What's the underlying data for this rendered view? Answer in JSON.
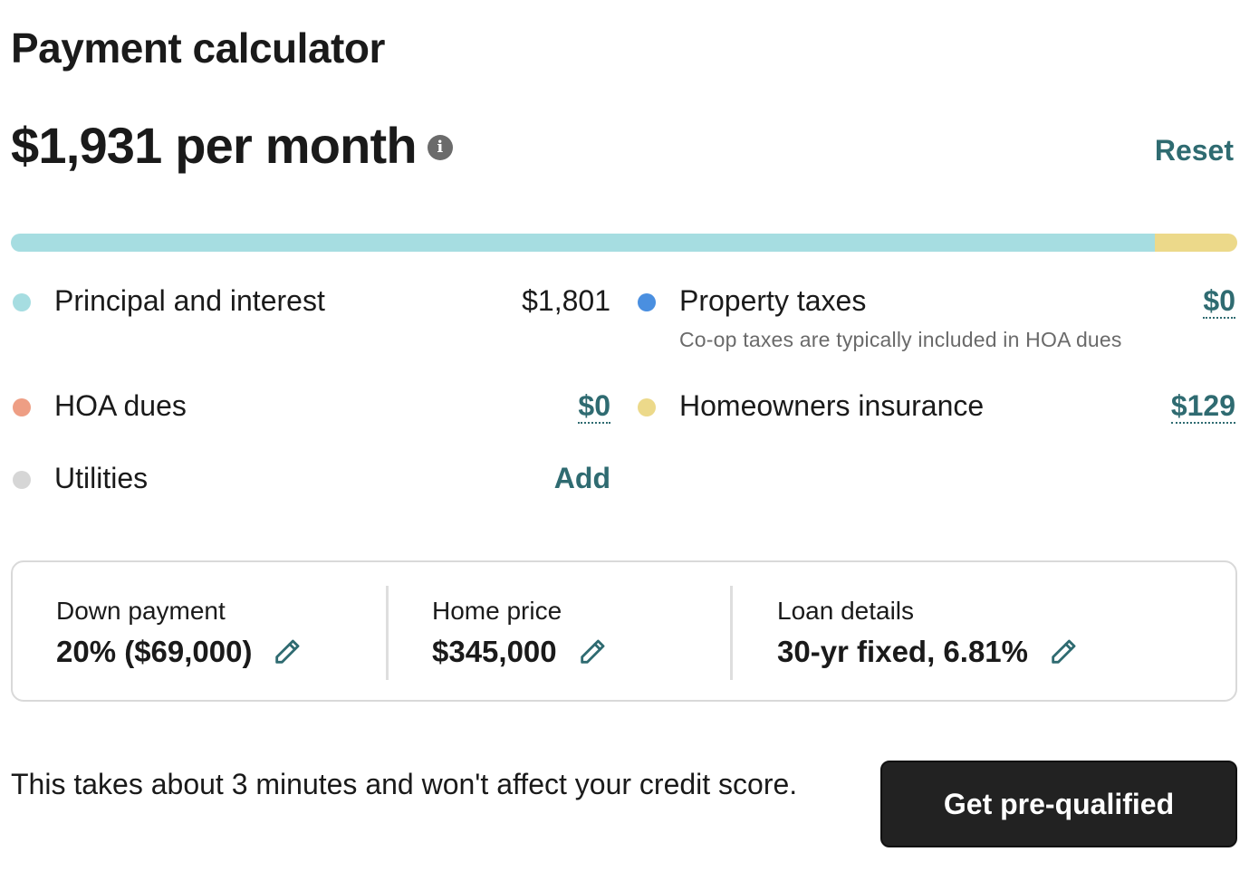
{
  "title": "Payment calculator",
  "summary": {
    "monthly_text": "$1,931 per month",
    "info_icon": "info-icon",
    "reset_label": "Reset"
  },
  "breakdown_bar": {
    "segments": [
      {
        "name": "Principal and interest",
        "value": 1801,
        "color": "#a6dde1"
      },
      {
        "name": "Property taxes",
        "value": 0,
        "color": "#4a8fe0"
      },
      {
        "name": "HOA dues",
        "value": 0,
        "color": "#ee9e84"
      },
      {
        "name": "Homeowners insurance",
        "value": 129,
        "color": "#ecd98a"
      },
      {
        "name": "Utilities",
        "value": 0,
        "color": "#d6d6d6"
      }
    ]
  },
  "items": {
    "principal": {
      "label": "Principal and interest",
      "value": "$1,801",
      "color": "#a6dde1"
    },
    "property_taxes": {
      "label": "Property taxes",
      "value": "$0",
      "note": "Co-op taxes are typically included in HOA dues",
      "color": "#4a8fe0"
    },
    "hoa": {
      "label": "HOA dues",
      "value": "$0",
      "color": "#ee9e84"
    },
    "insurance": {
      "label": "Homeowners insurance",
      "value": "$129",
      "color": "#ecd98a"
    },
    "utilities": {
      "label": "Utilities",
      "value": "Add",
      "color": "#d6d6d6"
    }
  },
  "details": {
    "down_payment": {
      "label": "Down payment",
      "value": "20% ($69,000)",
      "icon": "pencil-icon"
    },
    "home_price": {
      "label": "Home price",
      "value": "$345,000",
      "icon": "pencil-icon"
    },
    "loan": {
      "label": "Loan details",
      "value": "30-yr fixed, 6.81%",
      "icon": "pencil-icon"
    }
  },
  "footer": {
    "text": "This takes about 3 minutes and won't affect your credit score.",
    "cta_label": "Get pre-qualified"
  },
  "colors": {
    "accent": "#2f6b71",
    "cta_bg": "#222222"
  }
}
